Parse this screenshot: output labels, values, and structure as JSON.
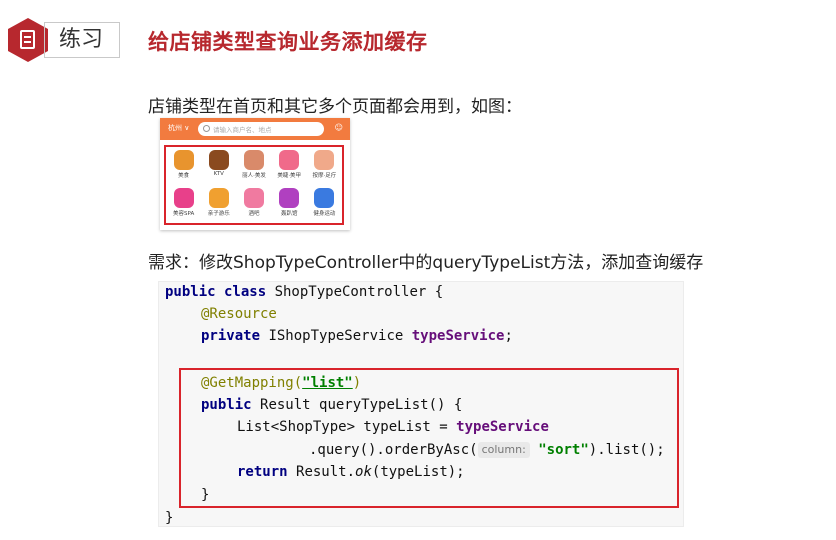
{
  "header": {
    "tab_label": "练习",
    "title": "给店铺类型查询业务添加缓存"
  },
  "intro_text": "店铺类型在首页和其它多个页面都会用到，如图：",
  "app": {
    "city": "杭州 ∨",
    "search_placeholder": "请输入商户名、地点",
    "categories": [
      {
        "label": "美食",
        "icon": "roast-chicken-icon",
        "color": "#e8942e"
      },
      {
        "label": "KTV",
        "icon": "microphone-icon",
        "color": "#8a4a1f"
      },
      {
        "label": "丽人·美发",
        "icon": "hair-icon",
        "color": "#d98a6a"
      },
      {
        "label": "美睫·美甲",
        "icon": "nail-icon",
        "color": "#f06a8a"
      },
      {
        "label": "按摩·足疗",
        "icon": "massage-icon",
        "color": "#f0a98a"
      },
      {
        "label": "美容SPA",
        "icon": "spa-icon",
        "color": "#e8408a"
      },
      {
        "label": "亲子游乐",
        "icon": "kid-icon",
        "color": "#f0a030"
      },
      {
        "label": "酒吧",
        "icon": "cocktail-icon",
        "color": "#f07aa0"
      },
      {
        "label": "轰趴馆",
        "icon": "mask-icon",
        "color": "#b040c0"
      },
      {
        "label": "健身运动",
        "icon": "dumbbell-icon",
        "color": "#3a7ae0"
      }
    ]
  },
  "requirement_text": "需求：修改ShopTypeController中的queryTypeList方法，添加查询缓存",
  "code": {
    "l1_kw": "public class ",
    "l1_rest": "ShopTypeController {",
    "l2_ann": "@Resource",
    "l3_kw": "private ",
    "l3_type": "IShopTypeService ",
    "l3_field": "typeService",
    "l3_end": ";",
    "l5_ann": "@GetMapping(",
    "l5_str": "\"list\"",
    "l5_end": ")",
    "l6_kw": "public ",
    "l6_rest": "Result queryTypeList() {",
    "l7_pre": "List<ShopType> typeList = ",
    "l7_field": "typeService",
    "l8_pre": ".query().orderByAsc(",
    "l8_hint": "column:",
    "l8_str": "\"sort\"",
    "l8_end": ").list();",
    "l9_kw": "return ",
    "l9_pre": "Result.",
    "l9_it": "ok",
    "l9_end": "(typeList);",
    "l10": "}",
    "l11": "}"
  }
}
